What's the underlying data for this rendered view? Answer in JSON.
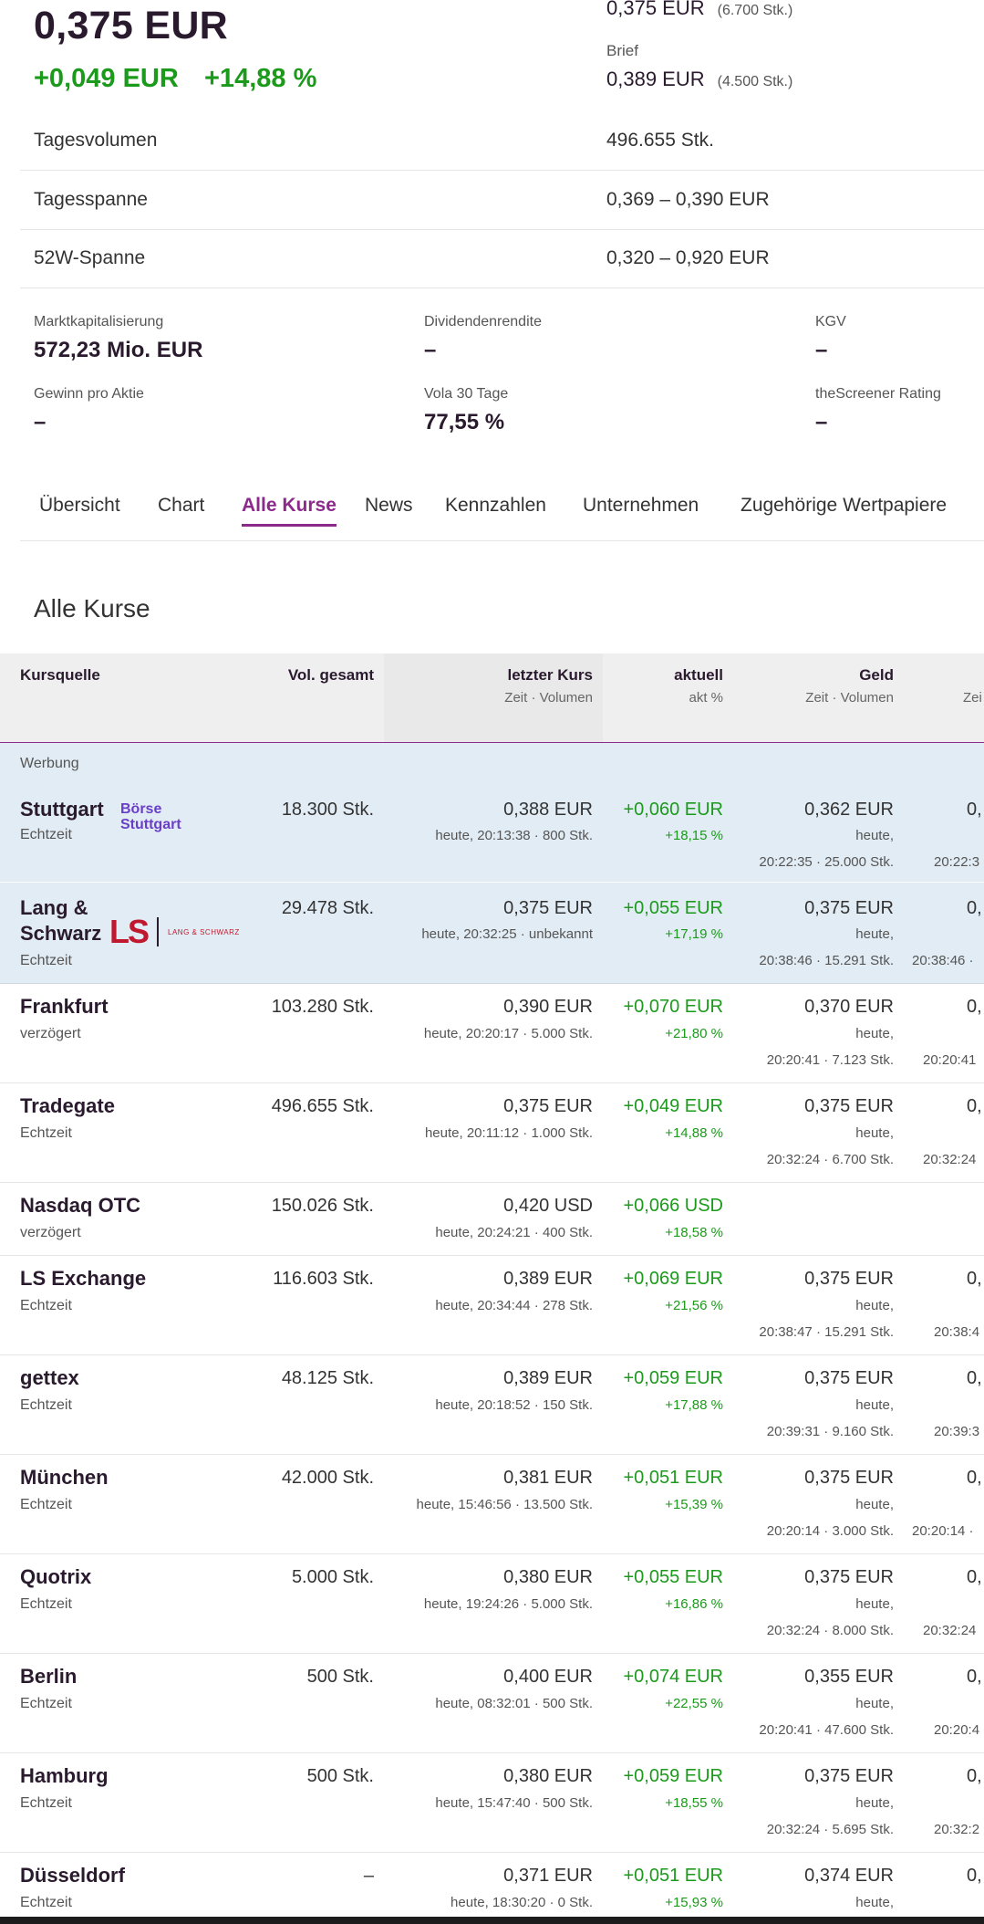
{
  "quote": {
    "price": "0,375 EUR",
    "change_abs": "+0,049 EUR",
    "change_pct": "+14,88 %",
    "geld_price": "0,375 EUR",
    "geld_qty": "(6.700 Stk.)",
    "brief_label": "Brief",
    "brief_price": "0,389 EUR",
    "brief_qty": "(4.500 Stk.)"
  },
  "kv": [
    {
      "label": "Tagesvolumen",
      "value": "496.655 Stk."
    },
    {
      "label": "Tagesspanne",
      "value": "0,369  –  0,390 EUR"
    },
    {
      "label": "52W-Spanne",
      "value": "0,320  –  0,920 EUR"
    }
  ],
  "stats": [
    {
      "label": "Marktkapitalisierung",
      "value": "572,23 Mio. EUR"
    },
    {
      "label": "Dividendenrendite",
      "value": "–"
    },
    {
      "label": "KGV",
      "value": "–"
    },
    {
      "label": "Gewinn pro Aktie",
      "value": "–"
    },
    {
      "label": "Vola 30 Tage",
      "value": "77,55 %"
    },
    {
      "label": "theScreener Rating",
      "value": "–"
    }
  ],
  "tabs": [
    "Übersicht",
    "Chart",
    "Alle Kurse",
    "News",
    "Kennzahlen",
    "Unternehmen",
    "Zugehörige Wertpapiere"
  ],
  "section_title": "Alle Kurse",
  "table": {
    "headers": {
      "source": "Kursquelle",
      "vol": "Vol. gesamt",
      "last": "letzter Kurs",
      "last_sub": "Zeit · Volumen",
      "akt": "aktuell",
      "akt_sub": "akt %",
      "geld": "Geld",
      "geld_sub": "Zeit · Volumen",
      "clip_sub": "Zei"
    },
    "ad_label": "Werbung",
    "logos": {
      "bs_line1": "Börse",
      "bs_line2": "Stuttgart",
      "ls_mark": "LS",
      "ls_text": "LANG & SCHWARZ"
    },
    "rows": [
      {
        "name": "Stuttgart",
        "type": "Echtzeit",
        "vol": "18.300 Stk.",
        "last": "0,388 EUR",
        "last_sub": "heute, 20:13:38 · 800 Stk.",
        "akt": "+0,060 EUR",
        "akt_pct": "+18,15 %",
        "geld": "0,362 EUR",
        "geld_day": "heute,",
        "geld_time": "20:22:35 · 25.000 Stk.",
        "clip_val": "0,",
        "clip_sub": "20:22:3"
      },
      {
        "name": "Lang &",
        "name2": "Schwarz",
        "type": "Echtzeit",
        "vol": "29.478 Stk.",
        "last": "0,375 EUR",
        "last_sub": "heute, 20:32:25 · unbekannt",
        "akt": "+0,055 EUR",
        "akt_pct": "+17,19 %",
        "geld": "0,375 EUR",
        "geld_day": "heute,",
        "geld_time": "20:38:46 · 15.291 Stk.",
        "clip_val": "0,",
        "clip_sub": "20:38:46 ·"
      },
      {
        "name": "Frankfurt",
        "type": "verzögert",
        "vol": "103.280 Stk.",
        "last": "0,390 EUR",
        "last_sub": "heute, 20:20:17 · 5.000 Stk.",
        "akt": "+0,070 EUR",
        "akt_pct": "+21,80 %",
        "geld": "0,370 EUR",
        "geld_day": "heute,",
        "geld_time": "20:20:41 · 7.123 Stk.",
        "clip_val": "0,",
        "clip_sub": "20:20:41"
      },
      {
        "name": "Tradegate",
        "type": "Echtzeit",
        "vol": "496.655 Stk.",
        "last": "0,375 EUR",
        "last_sub": "heute, 20:11:12 · 1.000 Stk.",
        "akt": "+0,049 EUR",
        "akt_pct": "+14,88 %",
        "geld": "0,375 EUR",
        "geld_day": "heute,",
        "geld_time": "20:32:24 · 6.700 Stk.",
        "clip_val": "0,",
        "clip_sub": "20:32:24"
      },
      {
        "name": "Nasdaq OTC",
        "type": "verzögert",
        "vol": "150.026 Stk.",
        "last": "0,420 USD",
        "last_sub": "heute, 20:24:21 · 400 Stk.",
        "akt": "+0,066 USD",
        "akt_pct": "+18,58 %",
        "geld": "",
        "geld_day": "",
        "geld_time": "",
        "clip_val": "",
        "clip_sub": ""
      },
      {
        "name": "LS Exchange",
        "type": "Echtzeit",
        "vol": "116.603 Stk.",
        "last": "0,389 EUR",
        "last_sub": "heute, 20:34:44 · 278 Stk.",
        "akt": "+0,069 EUR",
        "akt_pct": "+21,56 %",
        "geld": "0,375 EUR",
        "geld_day": "heute,",
        "geld_time": "20:38:47 · 15.291 Stk.",
        "clip_val": "0,",
        "clip_sub": "20:38:4"
      },
      {
        "name": "gettex",
        "type": "Echtzeit",
        "vol": "48.125 Stk.",
        "last": "0,389 EUR",
        "last_sub": "heute, 20:18:52 · 150 Stk.",
        "akt": "+0,059 EUR",
        "akt_pct": "+17,88 %",
        "geld": "0,375 EUR",
        "geld_day": "heute,",
        "geld_time": "20:39:31 · 9.160 Stk.",
        "clip_val": "0,",
        "clip_sub": "20:39:3"
      },
      {
        "name": "München",
        "type": "Echtzeit",
        "vol": "42.000 Stk.",
        "last": "0,381 EUR",
        "last_sub": "heute, 15:46:56 · 13.500 Stk.",
        "akt": "+0,051 EUR",
        "akt_pct": "+15,39 %",
        "geld": "0,375 EUR",
        "geld_day": "heute,",
        "geld_time": "20:20:14 · 3.000 Stk.",
        "clip_val": "0,",
        "clip_sub": "20:20:14 ·"
      },
      {
        "name": "Quotrix",
        "type": "Echtzeit",
        "vol": "5.000 Stk.",
        "last": "0,380 EUR",
        "last_sub": "heute, 19:24:26 · 5.000 Stk.",
        "akt": "+0,055 EUR",
        "akt_pct": "+16,86 %",
        "geld": "0,375 EUR",
        "geld_day": "heute,",
        "geld_time": "20:32:24 · 8.000 Stk.",
        "clip_val": "0,",
        "clip_sub": "20:32:24"
      },
      {
        "name": "Berlin",
        "type": "Echtzeit",
        "vol": "500 Stk.",
        "last": "0,400 EUR",
        "last_sub": "heute, 08:32:01 · 500 Stk.",
        "akt": "+0,074 EUR",
        "akt_pct": "+22,55 %",
        "geld": "0,355 EUR",
        "geld_day": "heute,",
        "geld_time": "20:20:41 · 47.600 Stk.",
        "clip_val": "0,",
        "clip_sub": "20:20:4"
      },
      {
        "name": "Hamburg",
        "type": "Echtzeit",
        "vol": "500 Stk.",
        "last": "0,380 EUR",
        "last_sub": "heute, 15:47:40 · 500 Stk.",
        "akt": "+0,059 EUR",
        "akt_pct": "+18,55 %",
        "geld": "0,375 EUR",
        "geld_day": "heute,",
        "geld_time": "20:32:24 · 5.695 Stk.",
        "clip_val": "0,",
        "clip_sub": "20:32:2"
      },
      {
        "name": "Düsseldorf",
        "type": "Echtzeit",
        "vol": "–",
        "last": "0,371 EUR",
        "last_sub": "heute, 18:30:20 · 0 Stk.",
        "akt": "+0,051 EUR",
        "akt_pct": "+15,93 %",
        "geld": "0,374 EUR",
        "geld_day": "heute,",
        "geld_time": "",
        "clip_val": "0,",
        "clip_sub": ""
      }
    ]
  }
}
